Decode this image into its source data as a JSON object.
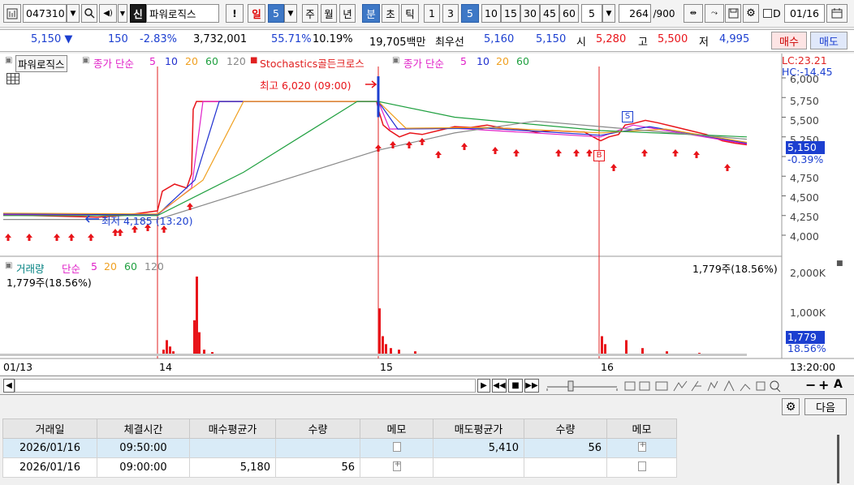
{
  "toolbar": {
    "code": "047310",
    "shin": "신",
    "name": "파워로직스",
    "alert": "!",
    "period_tabs": [
      "일",
      "5",
      "주",
      "월",
      "년",
      "분",
      "초",
      "틱"
    ],
    "interval_buttons": [
      "1",
      "3",
      "5",
      "10",
      "15",
      "30",
      "45",
      "60"
    ],
    "count": "5",
    "bars": "264",
    "bars_total": "/900",
    "date_label": "D",
    "date": "01/16"
  },
  "quote": {
    "price": "5,150 ▼",
    "change": "150",
    "rate": "-2.83%",
    "volume": "3,732,001",
    "vol_ratio": "55.71%",
    "turnover": "10.19%",
    "amount": "19,705백만",
    "best_label": "최우선",
    "best_ask": "5,160",
    "best_bid": "5,150",
    "open_label": "시",
    "open": "5,280",
    "high_label": "고",
    "high": "5,500",
    "low_label": "저",
    "low": "4,995",
    "buy_btn": "매수",
    "sell_btn": "매도"
  },
  "legend": {
    "name": "파워로직스",
    "ma_label": "종가 단순",
    "ma_periods": [
      "5",
      "10",
      "20",
      "60",
      "120"
    ],
    "stoch_label": "Stochastics골든크로스",
    "stoch_ma_label": "종가 단순",
    "stoch_periods": [
      "5",
      "10",
      "20",
      "60"
    ],
    "lc": "LC:23.21",
    "hc": "HC:-14.45"
  },
  "annotations": {
    "high": "최고 6,020 (09:00)",
    "low": "최저 4,185 (13:20)",
    "signal_b": "B",
    "signal_s": "S"
  },
  "price_axis": {
    "ticks": [
      "6,000",
      "5,750",
      "5,500",
      "5,250",
      "5,000",
      "4,750",
      "4,500",
      "4,250",
      "4,000"
    ],
    "current": "5,150",
    "current_change": "-0.39%"
  },
  "volume_panel": {
    "legend_name": "거래량",
    "legend_ma": "단순",
    "legend_periods": [
      "5",
      "20",
      "60",
      "120"
    ],
    "left_value": "1,779주(18.56%)",
    "right_value": "1,779주(18.56%)",
    "ticks": [
      "2,000K",
      "1,000K"
    ],
    "current": "1,779",
    "current_pct": "18.56%"
  },
  "time_axis": {
    "labels": [
      "01/13",
      "14",
      "15",
      "16"
    ],
    "right_label": "13:20:00"
  },
  "colors": {
    "up": "#e8141a",
    "down": "#1c3fd0",
    "ma5": "#e020c8",
    "ma10": "#2030d0",
    "ma20": "#f0a020",
    "ma60": "#20a040",
    "ma120": "#888888",
    "divider": "#e02020"
  },
  "chart_data": {
    "type": "line",
    "title": "파워로직스",
    "series": [
      {
        "name": "종가",
        "x": [
          "01/13",
          "14 09:20",
          "14 10:40",
          "14 11:00",
          "14 13:20",
          "15 09:00",
          "15 10:00",
          "15 14:00",
          "16 09:20",
          "16 10:20",
          "16 13:20"
        ],
        "values": [
          4260,
          4300,
          4400,
          4500,
          5700,
          5550,
          5300,
          5400,
          5200,
          5400,
          5150
        ]
      }
    ],
    "ylim": [
      3900,
      6050
    ],
    "annotations": [
      "최고 6,020 (09:00)",
      "최저 4,185 (13:20)"
    ]
  },
  "bottom": {
    "next_btn": "다음",
    "columns": [
      "거래일",
      "체결시간",
      "매수평균가",
      "수량",
      "메모",
      "매도평균가",
      "수량",
      "메모"
    ],
    "rows": [
      [
        "2026/01/16",
        "09:50:00",
        "",
        "",
        "",
        "5,410",
        "56",
        ""
      ],
      [
        "2026/01/16",
        "09:00:00",
        "5,180",
        "56",
        "",
        "",
        "",
        ""
      ]
    ]
  }
}
